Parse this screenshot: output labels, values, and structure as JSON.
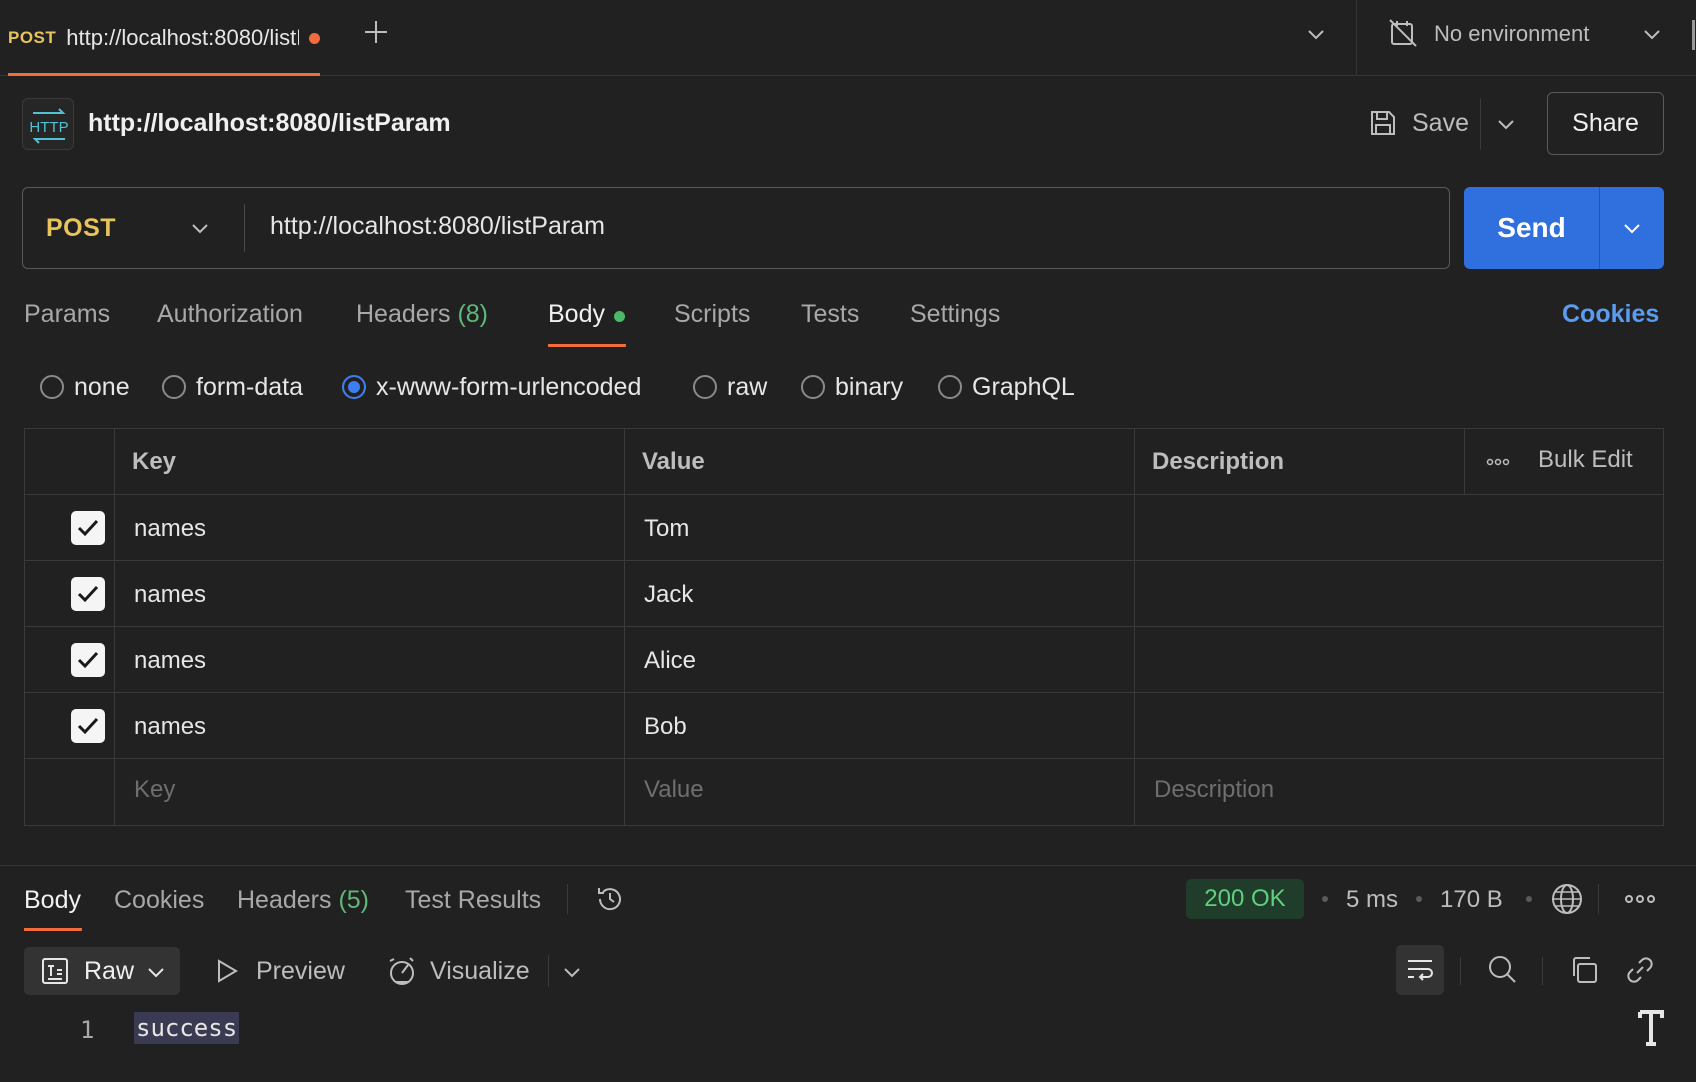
{
  "tab": {
    "method": "POST",
    "title": "http://localhost:8080/listParam"
  },
  "environment": {
    "label": "No environment"
  },
  "request": {
    "name": "http://localhost:8080/listParam",
    "save_label": "Save",
    "share_label": "Share",
    "method": "POST",
    "url": "http://localhost:8080/listParam",
    "send_label": "Send",
    "http_badge": "HTTP"
  },
  "request_tabs": [
    {
      "label": "Params"
    },
    {
      "label": "Authorization"
    },
    {
      "label": "Headers",
      "count": "(8)"
    },
    {
      "label": "Body"
    },
    {
      "label": "Scripts"
    },
    {
      "label": "Tests"
    },
    {
      "label": "Settings"
    }
  ],
  "active_request_tab": "Body",
  "cookies_link": "Cookies",
  "body_types": [
    {
      "label": "none",
      "selected": false
    },
    {
      "label": "form-data",
      "selected": false
    },
    {
      "label": "x-www-form-urlencoded",
      "selected": true
    },
    {
      "label": "raw",
      "selected": false
    },
    {
      "label": "binary",
      "selected": false
    },
    {
      "label": "GraphQL",
      "selected": false
    }
  ],
  "params_table": {
    "headers": {
      "key": "Key",
      "value": "Value",
      "description": "Description",
      "bulk_edit": "Bulk Edit"
    },
    "rows": [
      {
        "checked": true,
        "key": "names",
        "value": "Tom",
        "description": ""
      },
      {
        "checked": true,
        "key": "names",
        "value": "Jack",
        "description": ""
      },
      {
        "checked": true,
        "key": "names",
        "value": "Alice",
        "description": ""
      },
      {
        "checked": true,
        "key": "names",
        "value": "Bob",
        "description": ""
      }
    ],
    "placeholders": {
      "key": "Key",
      "value": "Value",
      "description": "Description"
    }
  },
  "response": {
    "tabs": [
      {
        "label": "Body"
      },
      {
        "label": "Cookies"
      },
      {
        "label": "Headers",
        "count": "(5)"
      },
      {
        "label": "Test Results"
      }
    ],
    "active_tab": "Body",
    "status": "200 OK",
    "time": "5 ms",
    "size": "170 B",
    "format_label": "Raw",
    "preview_label": "Preview",
    "visualize_label": "Visualize",
    "lines": [
      {
        "number": "1",
        "text": "success"
      }
    ]
  },
  "colors": {
    "background": "#212121",
    "accent_orange": "#f26b3a",
    "method_post": "#e8c45a",
    "send_blue": "#2f6fde",
    "status_green": "#5fd07e",
    "link_blue": "#5a9cf0"
  },
  "icons": {
    "add_tab": "plus-icon",
    "env": "no-environment-icon",
    "save": "floppy-disk-icon",
    "history": "history-icon",
    "globe": "globe-icon",
    "more": "more-horizontal-icon",
    "raw": "text-file-icon",
    "preview": "play-icon",
    "visualize": "visualize-icon",
    "wrap": "wrap-text-icon",
    "search": "search-icon",
    "copy": "copy-icon",
    "link": "link-icon"
  }
}
